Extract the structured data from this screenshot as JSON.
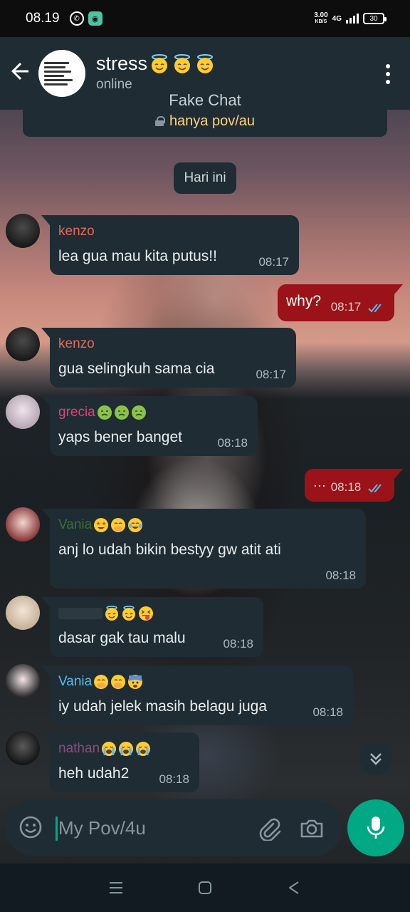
{
  "status_bar": {
    "time": "08.19",
    "net_speed_value": "3.00",
    "net_speed_unit": "KB/S",
    "network_type": "4G",
    "battery": "30"
  },
  "header": {
    "title": "stress",
    "title_emojis": [
      "smiling-face-with-halo",
      "smiling-face-with-halo",
      "smiling-face-with-halo"
    ],
    "status": "online",
    "caption": "Fake Chat"
  },
  "notice": {
    "text": "hanya pov/au"
  },
  "date_chip": "Hari ini",
  "messages": [
    {
      "sender": "kenzo",
      "sender_color": "#e26b5a",
      "text": "lea gua mau kita putus!!",
      "time": "08:17"
    },
    {
      "text": "why?",
      "time": "08:17",
      "outgoing": true
    },
    {
      "sender": "kenzo",
      "sender_color": "#e26b5a",
      "text": "gua selingkuh sama cia",
      "time": "08:17"
    },
    {
      "sender": "grecia",
      "sender_color": "#e5407a",
      "text": "yaps bener banget",
      "time": "08:18"
    },
    {
      "text": "···",
      "time": "08:18",
      "outgoing": true
    },
    {
      "sender": "Vania",
      "sender_color": "#3b6e3b",
      "text": "anj lo udah bikin bestyy gw atit ati",
      "time": "08:18"
    },
    {
      "text": "dasar gak tau malu",
      "time": "08:18"
    },
    {
      "sender": "Vania",
      "sender_color": "#53bdeb",
      "text": "iy udah jelek masih belagu juga",
      "time": "08:18"
    },
    {
      "sender": "nathan",
      "sender_color": "#8a4f7a",
      "text": "heh udah2",
      "time": "08:18"
    }
  ],
  "composer": {
    "placeholder": "My Pov/4u"
  },
  "colors": {
    "accent": "#00a884",
    "outgoing_bubble": "#9b1219",
    "incoming_bubble": "#1f2c34",
    "read_ticks": "#53bdeb",
    "notice_text": "#ffd279"
  }
}
